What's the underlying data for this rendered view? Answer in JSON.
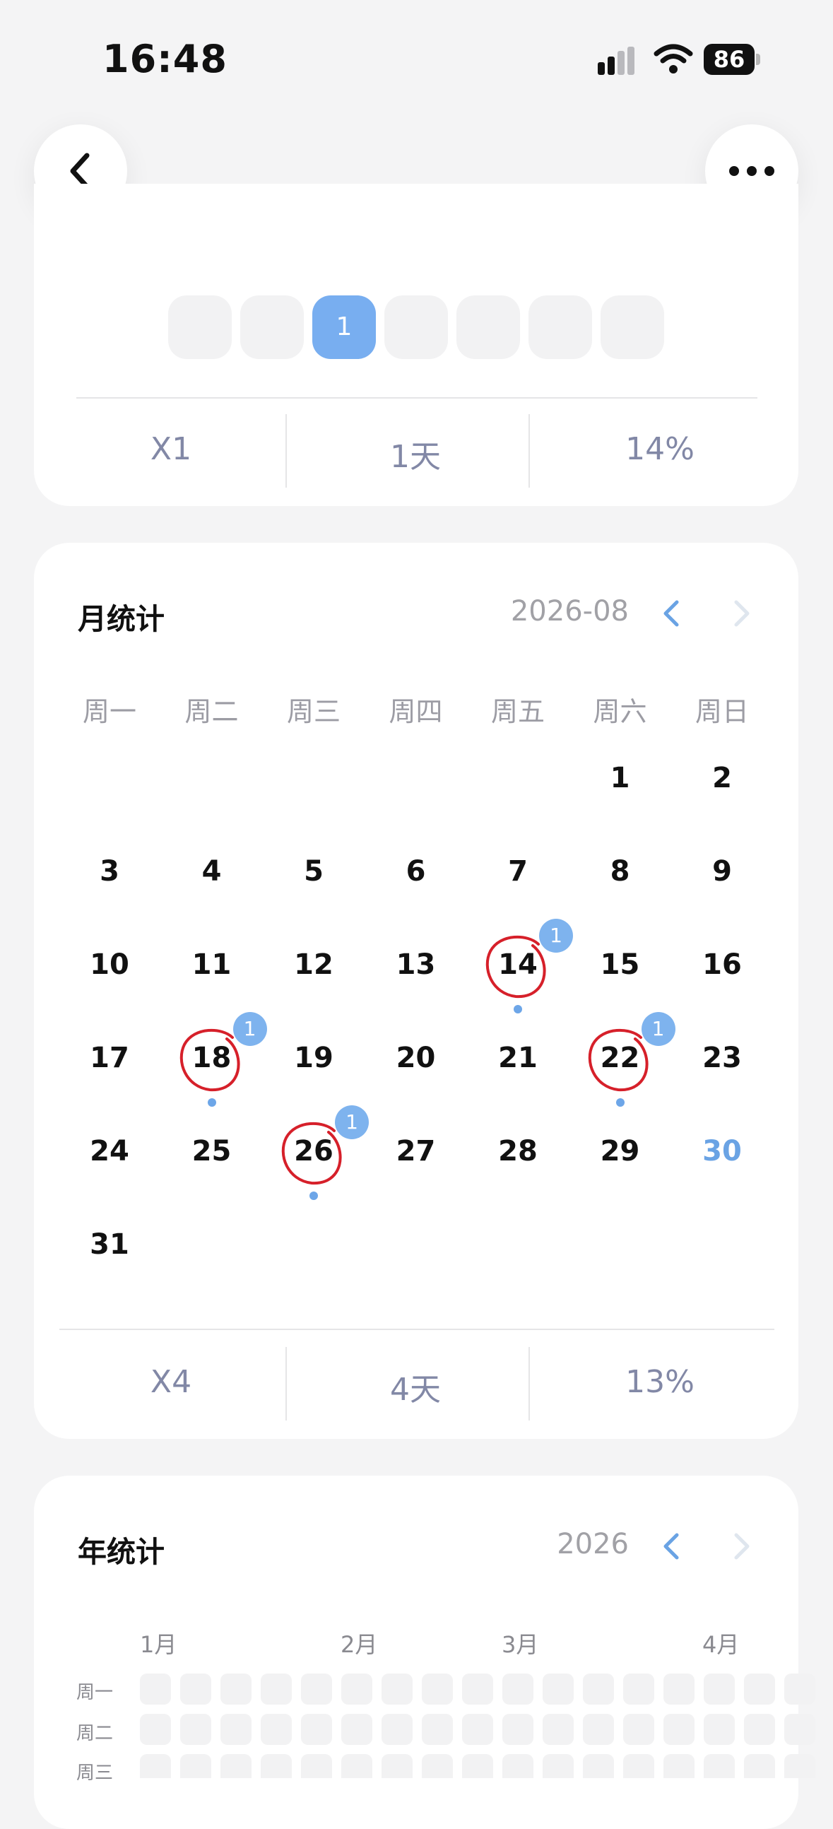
{
  "status_bar": {
    "time": "16:48",
    "battery": "86"
  },
  "week_summary": {
    "cells": [
      "",
      "",
      "1",
      "",
      "",
      "",
      ""
    ],
    "active_index": 2,
    "stats": [
      "X1",
      "1天",
      "14%"
    ]
  },
  "month_stats": {
    "title": "月统计",
    "period": "2026-08",
    "weekdays": [
      "周一",
      "周二",
      "周三",
      "周四",
      "周五",
      "周六",
      "周日"
    ],
    "first_weekday_index": 5,
    "days_in_month": 31,
    "today": 30,
    "marked_days": [
      {
        "day": "14",
        "count": "1"
      },
      {
        "day": "18",
        "count": "1"
      },
      {
        "day": "22",
        "count": "1"
      },
      {
        "day": "26",
        "count": "1"
      }
    ],
    "stats": [
      "X4",
      "4天",
      "13%"
    ]
  },
  "year_stats": {
    "title": "年统计",
    "period": "2026",
    "months": [
      "1月",
      "2月",
      "3月",
      "4月"
    ],
    "row_labels": [
      "周一",
      "周二",
      "周三"
    ]
  },
  "colors": {
    "accent": "#78aef0",
    "mark": "#d6202a",
    "stat_text": "#8288a6"
  }
}
